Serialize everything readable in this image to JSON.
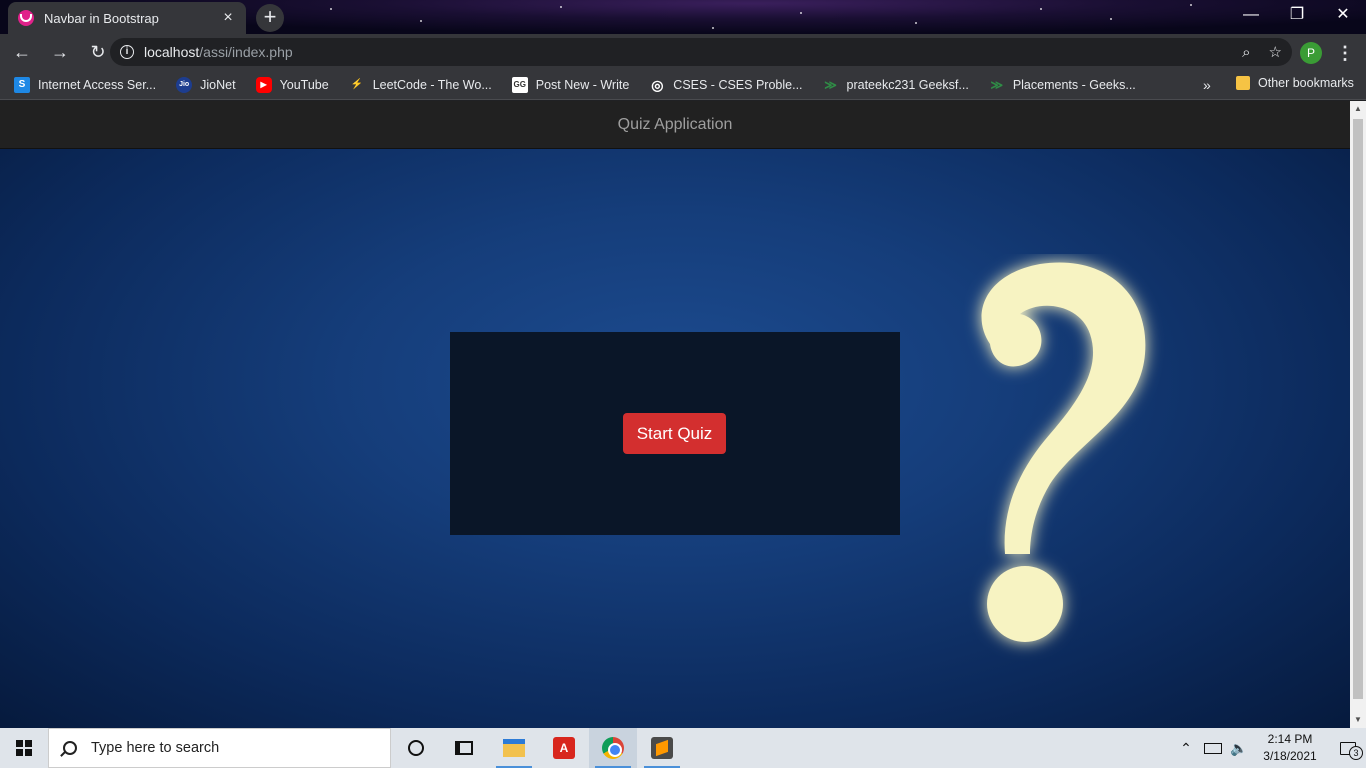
{
  "browser": {
    "tab_title": "Navbar in Bootstrap",
    "tab_close": "×",
    "new_tab": "+",
    "url_host": "localhost",
    "url_path": "/assi/index.php",
    "profile_initial": "P",
    "window_minimize": "—",
    "window_restore": "❐",
    "window_close": "✕"
  },
  "bookmarks": [
    {
      "label": "Internet Access Ser...",
      "icon_text": "S",
      "icon_color": "#1e88e5"
    },
    {
      "label": "JioNet",
      "icon_text": "Jio",
      "icon_color": "#1d3d8f"
    },
    {
      "label": "YouTube",
      "icon_text": "▶",
      "icon_color": "#ff0000"
    },
    {
      "label": "LeetCode - The Wo...",
      "icon_text": "⚡",
      "icon_color": "#35363a"
    },
    {
      "label": "Post New - Write",
      "icon_text": "GG",
      "icon_color": "#ffffff"
    },
    {
      "label": "CSES - CSES Proble...",
      "icon_text": "◎",
      "icon_color": "#35363a"
    },
    {
      "label": "prateekc231 Geeksf...",
      "icon_text": "≫",
      "icon_color": "#35363a"
    },
    {
      "label": "Placements - Geeks...",
      "icon_text": "≫",
      "icon_color": "#35363a"
    }
  ],
  "bookmarks_more": "»",
  "other_bookmarks": "Other bookmarks",
  "page": {
    "navbar_title": "Quiz Application",
    "start_button": "Start Quiz"
  },
  "taskbar": {
    "search_placeholder": "Type here to search",
    "time": "2:14 PM",
    "date": "3/18/2021",
    "notification_count": "3"
  },
  "colors": {
    "accent_button": "#d32f2f",
    "navbar_bg": "#212121",
    "hero_bg": "#153d7a"
  }
}
